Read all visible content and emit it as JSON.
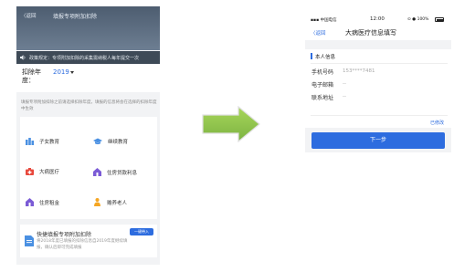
{
  "left_screen": {
    "back_label": "〈返回",
    "title": "填报专项附加扣除",
    "notice": "政策规定：专项附加扣除的采集需纳税人每年提交一次",
    "year_label": "扣除年度：",
    "year_value": "2019",
    "hint": "填报专项附加扣除之前请选择扣除年度，填报的信息将会在选择的扣除年度中生效",
    "categories": [
      {
        "label": "子女教育",
        "icon": "children-education-icon",
        "color": "#4a90e2"
      },
      {
        "label": "继续教育",
        "icon": "continuing-education-icon",
        "color": "#4a90e2"
      },
      {
        "label": "大病医疗",
        "icon": "medical-icon",
        "color": "#e8483c"
      },
      {
        "label": "住房贷款利息",
        "icon": "house-loan-icon",
        "color": "#7b5bd6"
      },
      {
        "label": "住房租金",
        "icon": "house-rent-icon",
        "color": "#7b5bd6"
      },
      {
        "label": "赡养老人",
        "icon": "elderly-support-icon",
        "color": "#f5a623"
      }
    ],
    "quick_fill": {
      "title": "快捷填报专项附加扣除",
      "button": "一键带入",
      "description": "将2018年度已填报的扣除信息自2019年度继续填报，确认后即可完成填报"
    }
  },
  "right_screen": {
    "status": {
      "carrier": "中国电信",
      "time": "12:00",
      "battery": "100%"
    },
    "back_label": "〈返回",
    "title": "大病医疗信息填写",
    "section_title": "本人信息",
    "fields": [
      {
        "label": "手机号码",
        "value": "153****7481"
      },
      {
        "label": "电子邮箱",
        "value": "--"
      },
      {
        "label": "联系地址",
        "value": "--"
      }
    ],
    "edit_label": "已修改",
    "next_button": "下一步"
  },
  "colors": {
    "accent": "#2d6cdf",
    "arrow": "#8cc63f"
  }
}
